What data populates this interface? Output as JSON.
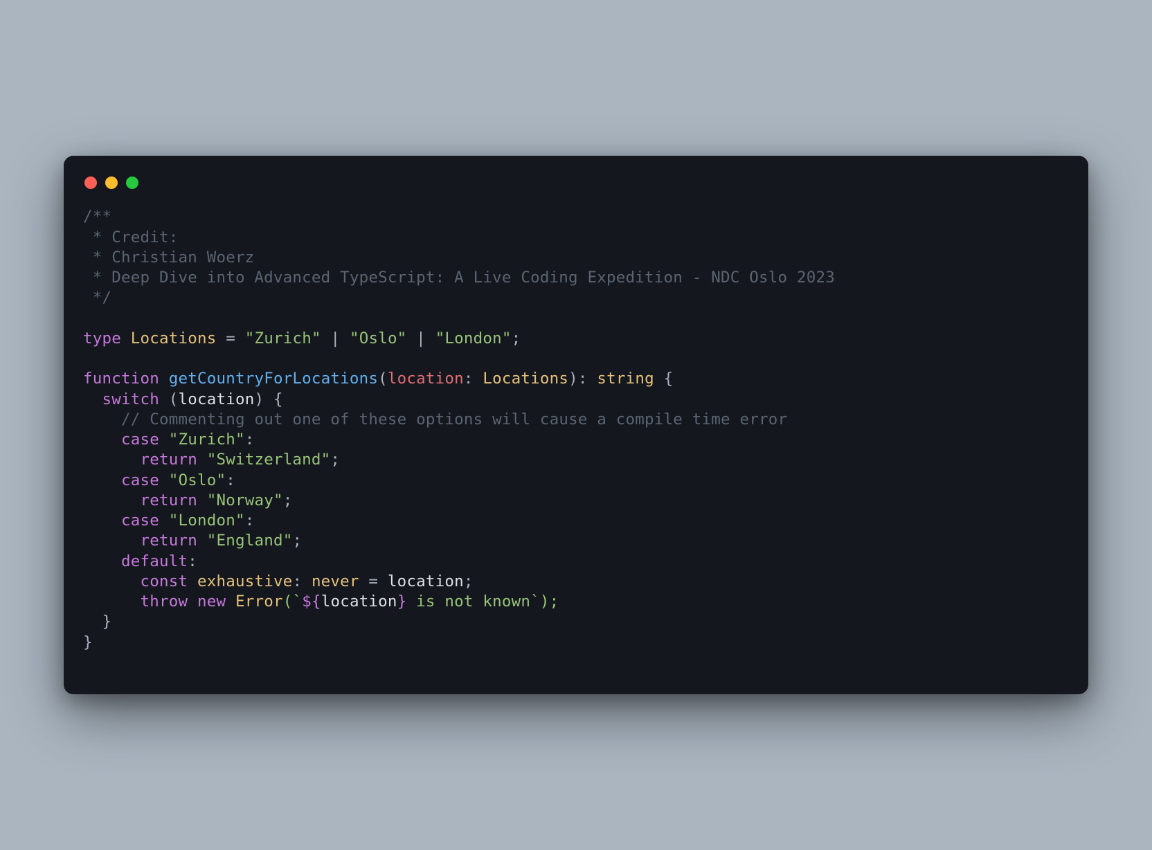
{
  "code": {
    "docblock": {
      "open": "/**",
      "line1": " * Credit:",
      "line2": " * Christian Woerz",
      "line3": " * Deep Dive into Advanced TypeScript: A Live Coding Expedition - NDC Oslo 2023",
      "close": " */"
    },
    "kw_type": "type",
    "type_name": "Locations",
    "eq": " = ",
    "union1": "\"Zurich\"",
    "union_pipe": " | ",
    "union2": "\"Oslo\"",
    "union3": "\"London\"",
    "semi": ";",
    "kw_function": "function",
    "func_name": "getCountryForLocations",
    "paren_open": "(",
    "param_name": "location",
    "colon_sp": ": ",
    "param_type": "Locations",
    "paren_close_colon": "): ",
    "ret_type": "string",
    "brace_open": " {",
    "kw_switch": "switch",
    "switch_expr_open": " (",
    "switch_var": "location",
    "switch_expr_close": ") {",
    "inline_comment": "// Commenting out one of these options will cause a compile time error",
    "kw_case": "case",
    "case1_val": "\"Zurich\"",
    "kw_return": "return",
    "ret1_val": "\"Switzerland\"",
    "case2_val": "\"Oslo\"",
    "ret2_val": "\"Norway\"",
    "case3_val": "\"London\"",
    "ret3_val": "\"England\"",
    "kw_default": "default",
    "kw_const": "const",
    "const_name": "exhaustive",
    "never_type": "never",
    "eq_sp": " = ",
    "assign_var": "location",
    "kw_throw": "throw",
    "kw_new": "new",
    "error_cls": "Error",
    "tmpl_open": "(`",
    "tmpl_interp_open": "${",
    "tmpl_interp_var": "location",
    "tmpl_interp_close": "}",
    "tmpl_tail": " is not known",
    "tmpl_close": "`);",
    "brace_close": "}",
    "colon": ":"
  },
  "traffic": {
    "red": "#ff5f56",
    "yellow": "#ffbd2e",
    "green": "#27c93f"
  }
}
